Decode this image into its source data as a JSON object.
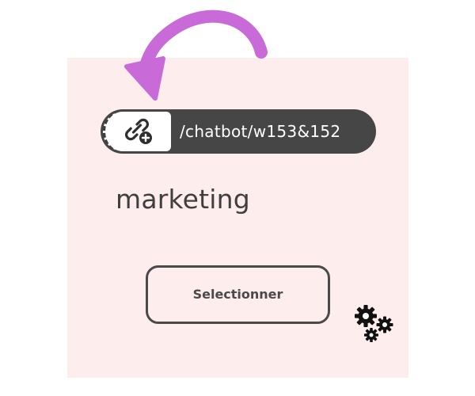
{
  "url_bar": {
    "path": "/chatbot/w153&152",
    "link_icon": "link-add-icon"
  },
  "card": {
    "title": "marketing",
    "background": "#fdeeed"
  },
  "select_button": {
    "label": "Selectionner"
  },
  "settings": {
    "icon": "gears-icon"
  },
  "annotation": {
    "arrow_icon": "curved-arrow-icon",
    "color": "#c96ad9"
  }
}
